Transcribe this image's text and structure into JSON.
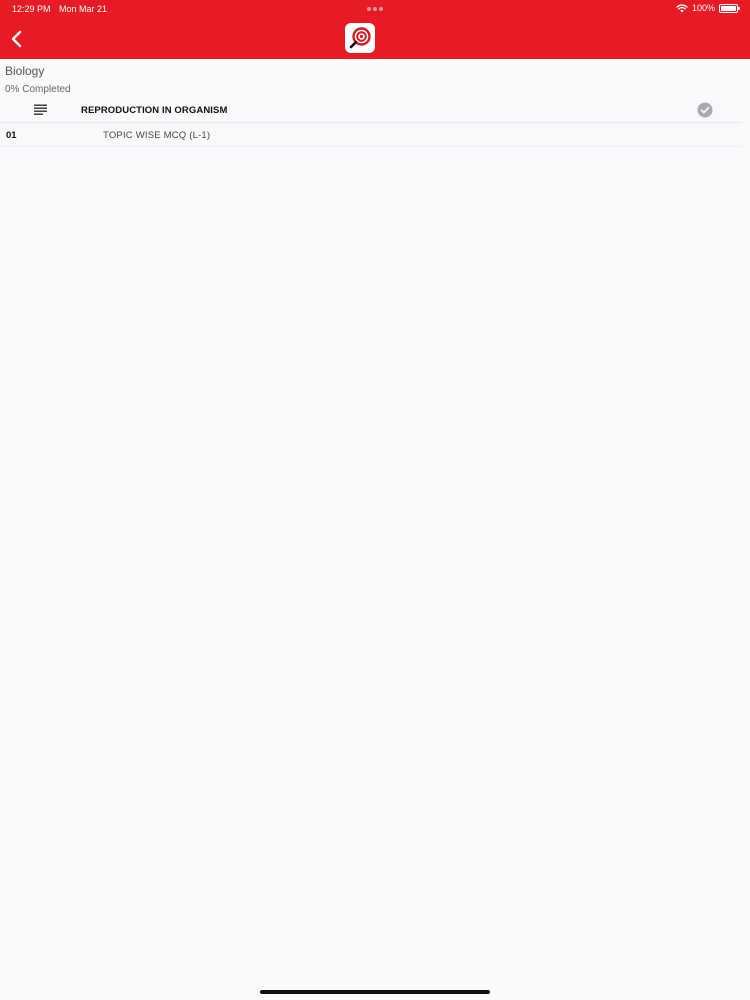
{
  "status_bar": {
    "time": "12:29 PM",
    "date": "Mon Mar 21",
    "battery": "100%",
    "icons": [
      "wifi-icon",
      "battery-icon"
    ]
  },
  "header": {
    "back_icon": "chevron-left-icon",
    "logo_icon": "target-magnifier-logo",
    "background_color": "#e61b23"
  },
  "course": {
    "title": "Biology",
    "progress": "0% Completed"
  },
  "chapter": {
    "icon": "list-icon",
    "title": "REPRODUCTION IN ORGANISM",
    "status_icon": "check-circle-icon"
  },
  "topics": [
    {
      "number": "01",
      "title": "TOPIC WISE MCQ (L-1)"
    }
  ]
}
